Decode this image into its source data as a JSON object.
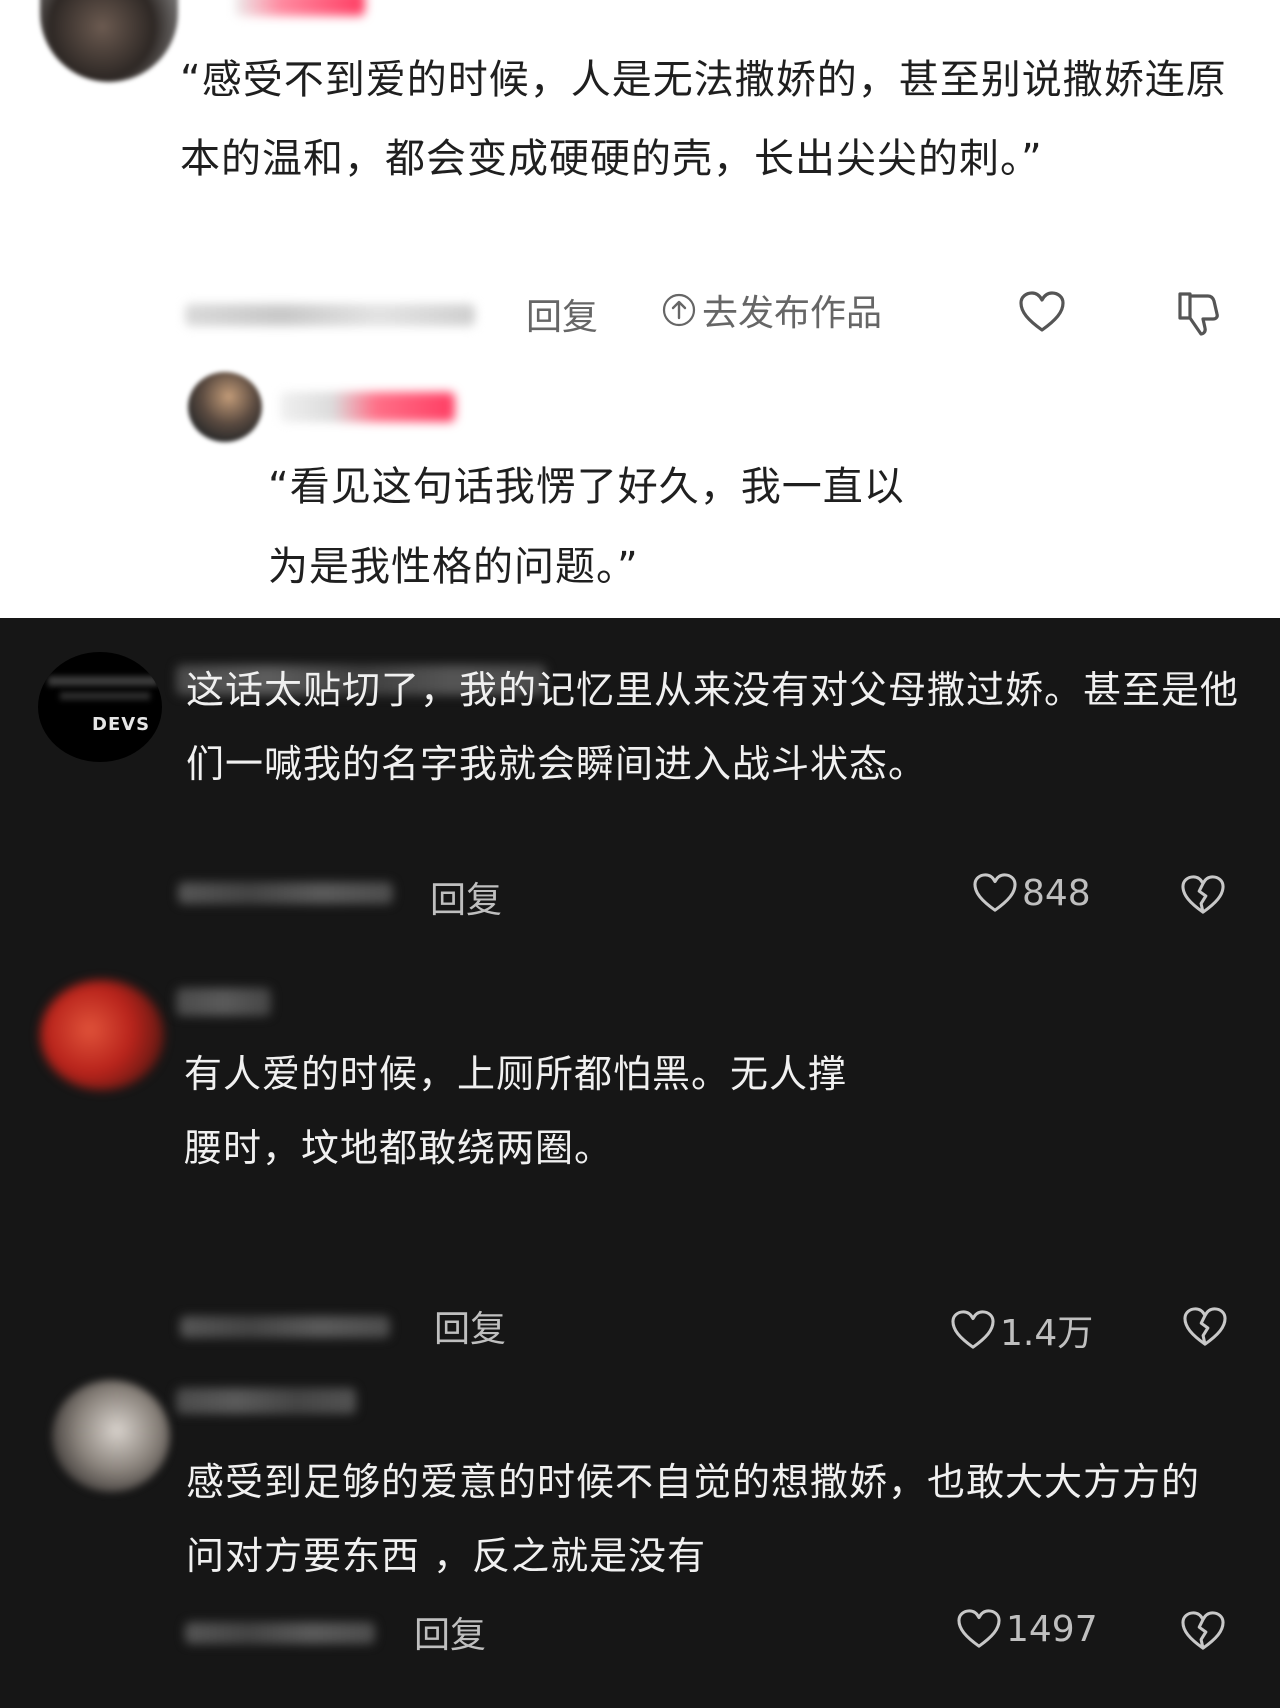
{
  "quote_post": {
    "text": "“感受不到爱的时候，人是无法撒娇的，甚至别说撒娇连原本的温和，都会变成硬硬的壳，长出尖尖的刺。”",
    "reply_label": "回复",
    "publish_label": "去发布作品"
  },
  "nested_reply": {
    "text": "“看见这句话我愣了好久，我一直以为是我性格的问题。”"
  },
  "comments": [
    {
      "avatar_text": "DEVS",
      "text": "这话太贴切了，我的记忆里从来没有对父母撒过娇。甚至是他们一喊我的名字我就会瞬间进入战斗状态。",
      "reply_label": "回复",
      "likes": "848"
    },
    {
      "text": "有人爱的时候，上厕所都怕黑。无人撑腰时，坟地都敢绕两圈。",
      "reply_label": "回复",
      "likes": "1.4万"
    },
    {
      "text": "感受到足够的爱意的时候不自觉的想撒娇，也敢大大方方的问对方要东西 ，反之就是没有",
      "reply_label": "回复",
      "likes": "1497"
    }
  ],
  "icons": {
    "like": "heart-outline-icon",
    "dislike_light": "thumbs-down-icon",
    "dislike_dark": "broken-heart-icon",
    "publish": "upload-circle-icon"
  },
  "colors": {
    "light_bg": "#ffffff",
    "dark_bg": "#161616",
    "username_tag": "#ff4d6d"
  }
}
